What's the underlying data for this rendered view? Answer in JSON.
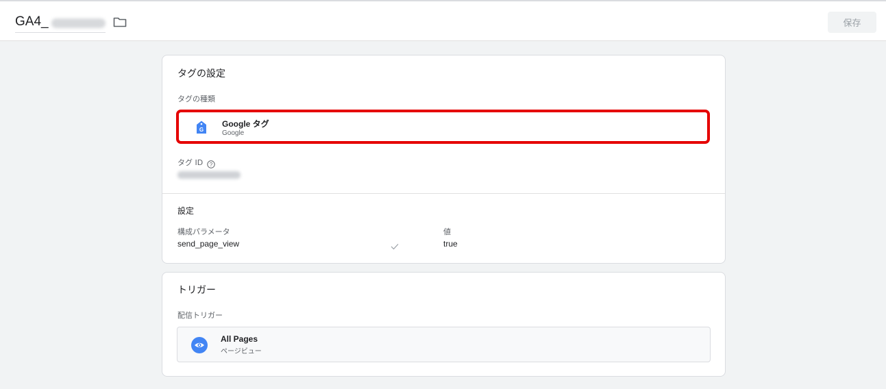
{
  "header": {
    "title": "GA4_",
    "save_label": "保存"
  },
  "tag_config": {
    "section_title": "タグの設定",
    "tag_type_label": "タグの種類",
    "tag_type": {
      "name": "Google タグ",
      "provider": "Google"
    },
    "tag_id_label": "タグ ID",
    "settings_title": "設定",
    "param_header": "構成パラメータ",
    "value_header": "値",
    "params": [
      {
        "name": "send_page_view",
        "value": "true"
      }
    ]
  },
  "triggers": {
    "section_title": "トリガー",
    "firing_label": "配信トリガー",
    "items": [
      {
        "name": "All Pages",
        "type": "ページビュー"
      }
    ]
  },
  "colors": {
    "highlight": "#e50000",
    "google_blue": "#4285f4"
  },
  "icons": {
    "folder": "folder-icon",
    "tag": "google-tag-icon",
    "help": "help-circle-icon",
    "check": "check-icon",
    "eye": "eye-icon"
  }
}
